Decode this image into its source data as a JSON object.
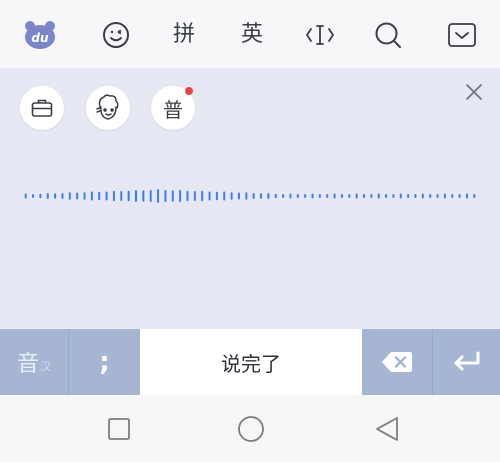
{
  "toolbar": {
    "logo_text": "du",
    "pinyin_label": "拼",
    "english_label": "英",
    "icons": [
      "du-logo-icon",
      "emoji-icon",
      "cursor-icon",
      "search-icon",
      "collapse-keyboard-icon"
    ]
  },
  "voice_panel": {
    "tools": [
      {
        "name": "toolbox",
        "icon": "briefcase-icon"
      },
      {
        "name": "avatar",
        "icon": "avatar-icon"
      },
      {
        "name": "mandarin",
        "label": "普",
        "has_notification": true
      }
    ],
    "close_icon": "close-icon"
  },
  "key_row": {
    "language_label": "音",
    "language_sub": "汉",
    "semicolon_label": ";",
    "done_label": "说完了",
    "delete_icon": "backspace-icon",
    "enter_icon": "enter-icon"
  },
  "colors": {
    "accent": "#3d7cf0",
    "panel_bg": "#e6e9f3",
    "key_row_bg": "#a6b5d2",
    "notification": "#f2403e"
  }
}
